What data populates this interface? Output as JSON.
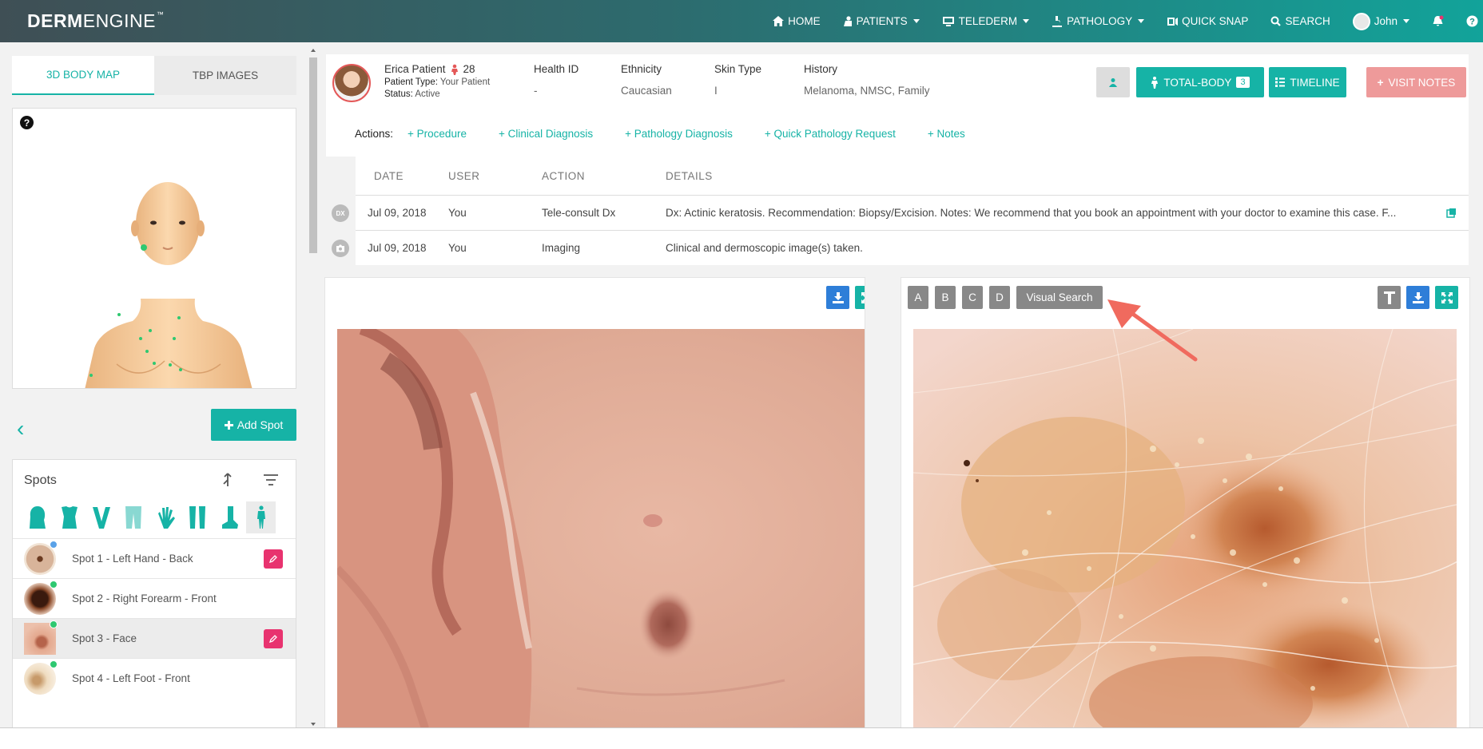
{
  "brand": {
    "part1": "DERM",
    "part2": "ENGINE",
    "tm": "™"
  },
  "nav": {
    "home": "HOME",
    "patients": "PATIENTS",
    "telederm": "TELEDERM",
    "pathology": "PATHOLOGY",
    "quick_snap": "QUICK SNAP",
    "search": "SEARCH",
    "user": "John"
  },
  "left": {
    "tabs": [
      "3D BODY MAP",
      "TBP IMAGES"
    ],
    "help": "?",
    "add_spot": "Add Spot",
    "spots_title": "Spots",
    "spots": [
      {
        "label": "Spot 1 - Left Hand - Back",
        "dot": "blue",
        "editable": true
      },
      {
        "label": "Spot 2 - Right Forearm - Front",
        "dot": "green",
        "editable": false
      },
      {
        "label": "Spot 3 - Face",
        "dot": "green",
        "editable": true,
        "selected": true
      },
      {
        "label": "Spot 4 - Left Foot - Front",
        "dot": "green",
        "editable": false
      }
    ],
    "bodypart_icons": [
      "head-icon",
      "torso-icon",
      "neck-icon",
      "legs-icon",
      "hand-icon",
      "lower-legs-icon",
      "foot-icon",
      "full-body-icon"
    ]
  },
  "patient": {
    "name": "Erica Patient",
    "age": "28",
    "type_label": "Patient Type:",
    "type_value": "Your Patient",
    "status_label": "Status:",
    "status_value": "Active",
    "health_id_label": "Health ID",
    "health_id": "-",
    "ethnicity_label": "Ethnicity",
    "ethnicity": "Caucasian",
    "skin_type_label": "Skin Type",
    "skin_type": "I",
    "history_label": "History",
    "history": "Melanoma, NMSC, Family",
    "buttons": {
      "total_body": "TOTAL-BODY",
      "total_body_count": "3",
      "timeline": "TIMELINE",
      "visit_notes": "VISIT NOTES"
    }
  },
  "actions": {
    "label": "Actions:",
    "links": [
      "+ Procedure",
      "+ Clinical Diagnosis",
      "+ Pathology Diagnosis",
      "+ Quick Pathology Request",
      "+ Notes"
    ]
  },
  "timeline": {
    "headers": [
      "DATE",
      "USER",
      "ACTION",
      "DETAILS"
    ],
    "rows": [
      {
        "icon": "DX",
        "date": "Jul 09, 2018",
        "user": "You",
        "action": "Tele-consult Dx",
        "details": "Dx: Actinic keratosis. Recommendation: Biopsy/Excision. Notes: We recommend that you book an appointment with your doctor to examine this case. F..."
      },
      {
        "icon": "camera",
        "date": "Jul 09, 2018",
        "user": "You",
        "action": "Imaging",
        "details": "Clinical and dermoscopic image(s) taken."
      }
    ]
  },
  "dermo_panel": {
    "abcd": [
      "A",
      "B",
      "C",
      "D"
    ],
    "visual_search": "Visual Search"
  },
  "colors": {
    "accent": "#16b3a6",
    "visit_notes": "#ee9a9a",
    "edit": "#e8336f",
    "blue_tool": "#2e7ed8",
    "annotation_arrow": "#f06a5e"
  }
}
